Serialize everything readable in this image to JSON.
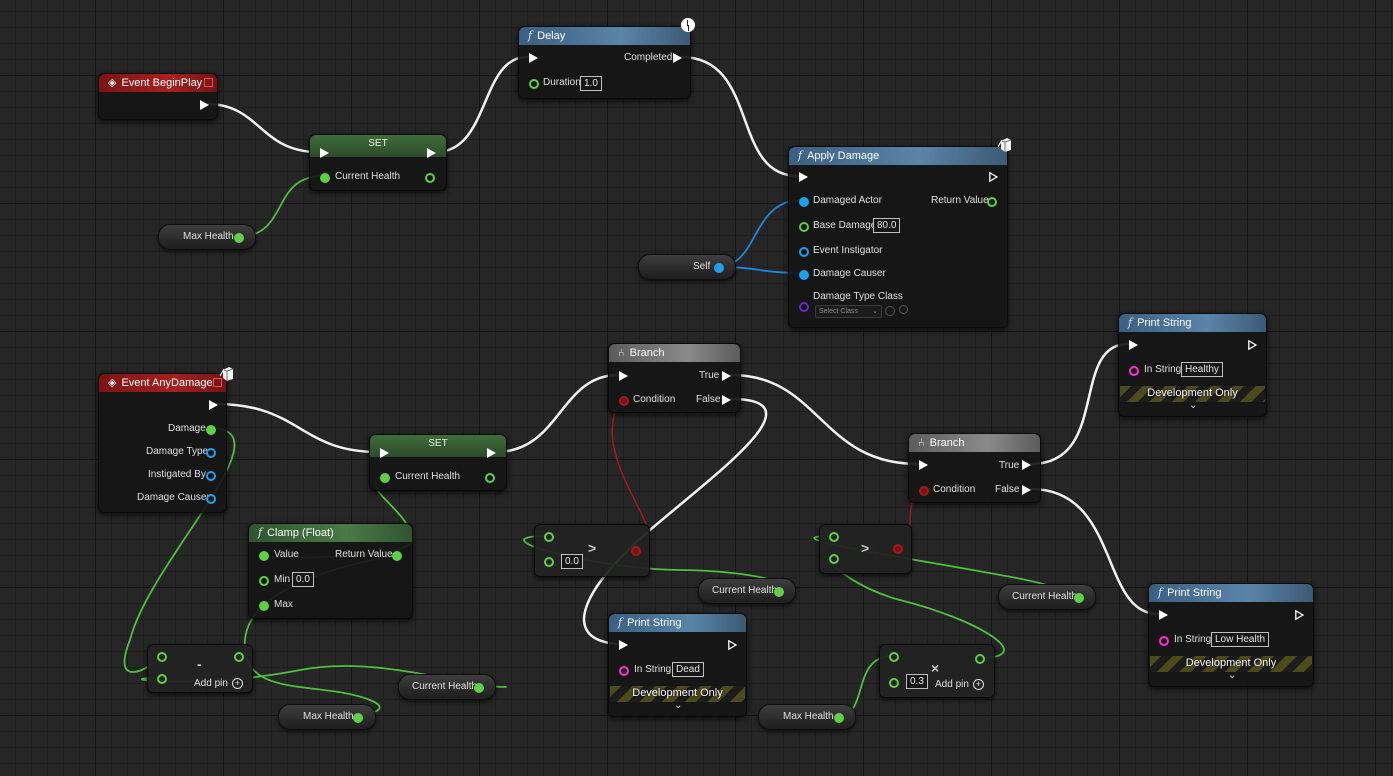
{
  "graph": {
    "event_begin_play": {
      "title": "Event BeginPlay"
    },
    "set_top": {
      "title": "SET",
      "pin": "Current Health"
    },
    "max_health_top": {
      "label": "Max Health"
    },
    "delay": {
      "title": "Delay",
      "completed": "Completed",
      "duration_label": "Duration",
      "duration_value": "1.0"
    },
    "apply_damage": {
      "title": "Apply Damage",
      "damaged_actor": "Damaged Actor",
      "return_value": "Return Value",
      "base_damage": "Base Damage",
      "base_damage_value": "80.0",
      "event_instigator": "Event Instigator",
      "damage_causer": "Damage Causer",
      "damage_type_class": "Damage Type Class",
      "select_class": "Select Class"
    },
    "self_node": {
      "label": "Self"
    },
    "event_any_damage": {
      "title": "Event AnyDamage",
      "damage": "Damage",
      "damage_type": "Damage Type",
      "instigated_by": "Instigated By",
      "damage_causer": "Damage Causer"
    },
    "set_bottom": {
      "title": "SET",
      "pin": "Current Health"
    },
    "clamp": {
      "title": "Clamp (Float)",
      "value": "Value",
      "return_value": "Return Value",
      "min": "Min",
      "min_value": "0.0",
      "max": "Max"
    },
    "subtract": {
      "symbol": "-",
      "add_pin": "Add pin"
    },
    "current_health_bottom": {
      "label": "Current Health"
    },
    "max_health_bottom": {
      "label": "Max Health"
    },
    "branch_1": {
      "title": "Branch",
      "true": "True",
      "false": "False",
      "condition": "Condition"
    },
    "compare_1": {
      "symbol": ">",
      "value": "0.0"
    },
    "current_health_mid": {
      "label": "Current Health"
    },
    "print_dead": {
      "title": "Print String",
      "in_string": "In String",
      "value": "Dead",
      "dev_only": "Development Only"
    },
    "branch_2": {
      "title": "Branch",
      "true": "True",
      "false": "False",
      "condition": "Condition"
    },
    "compare_2": {
      "symbol": ">"
    },
    "current_health_right": {
      "label": "Current Health"
    },
    "multiply": {
      "symbol": "×",
      "value": "0.3",
      "add_pin": "Add pin"
    },
    "max_health_right": {
      "label": "Max Health"
    },
    "print_healthy": {
      "title": "Print String",
      "in_string": "In String",
      "value": "Healthy",
      "dev_only": "Development Only"
    },
    "print_low": {
      "title": "Print String",
      "in_string": "In String",
      "value": "Low Health",
      "dev_only": "Development Only"
    }
  },
  "colors": {
    "exec_wire": "#ffffff",
    "float_wire": "#5fd045",
    "object_wire": "#1e9ff0",
    "bool_wire": "#a11a1a",
    "function_header": "#4a7396",
    "event_header": "#a11b1b",
    "set_header": "#3b6537"
  }
}
